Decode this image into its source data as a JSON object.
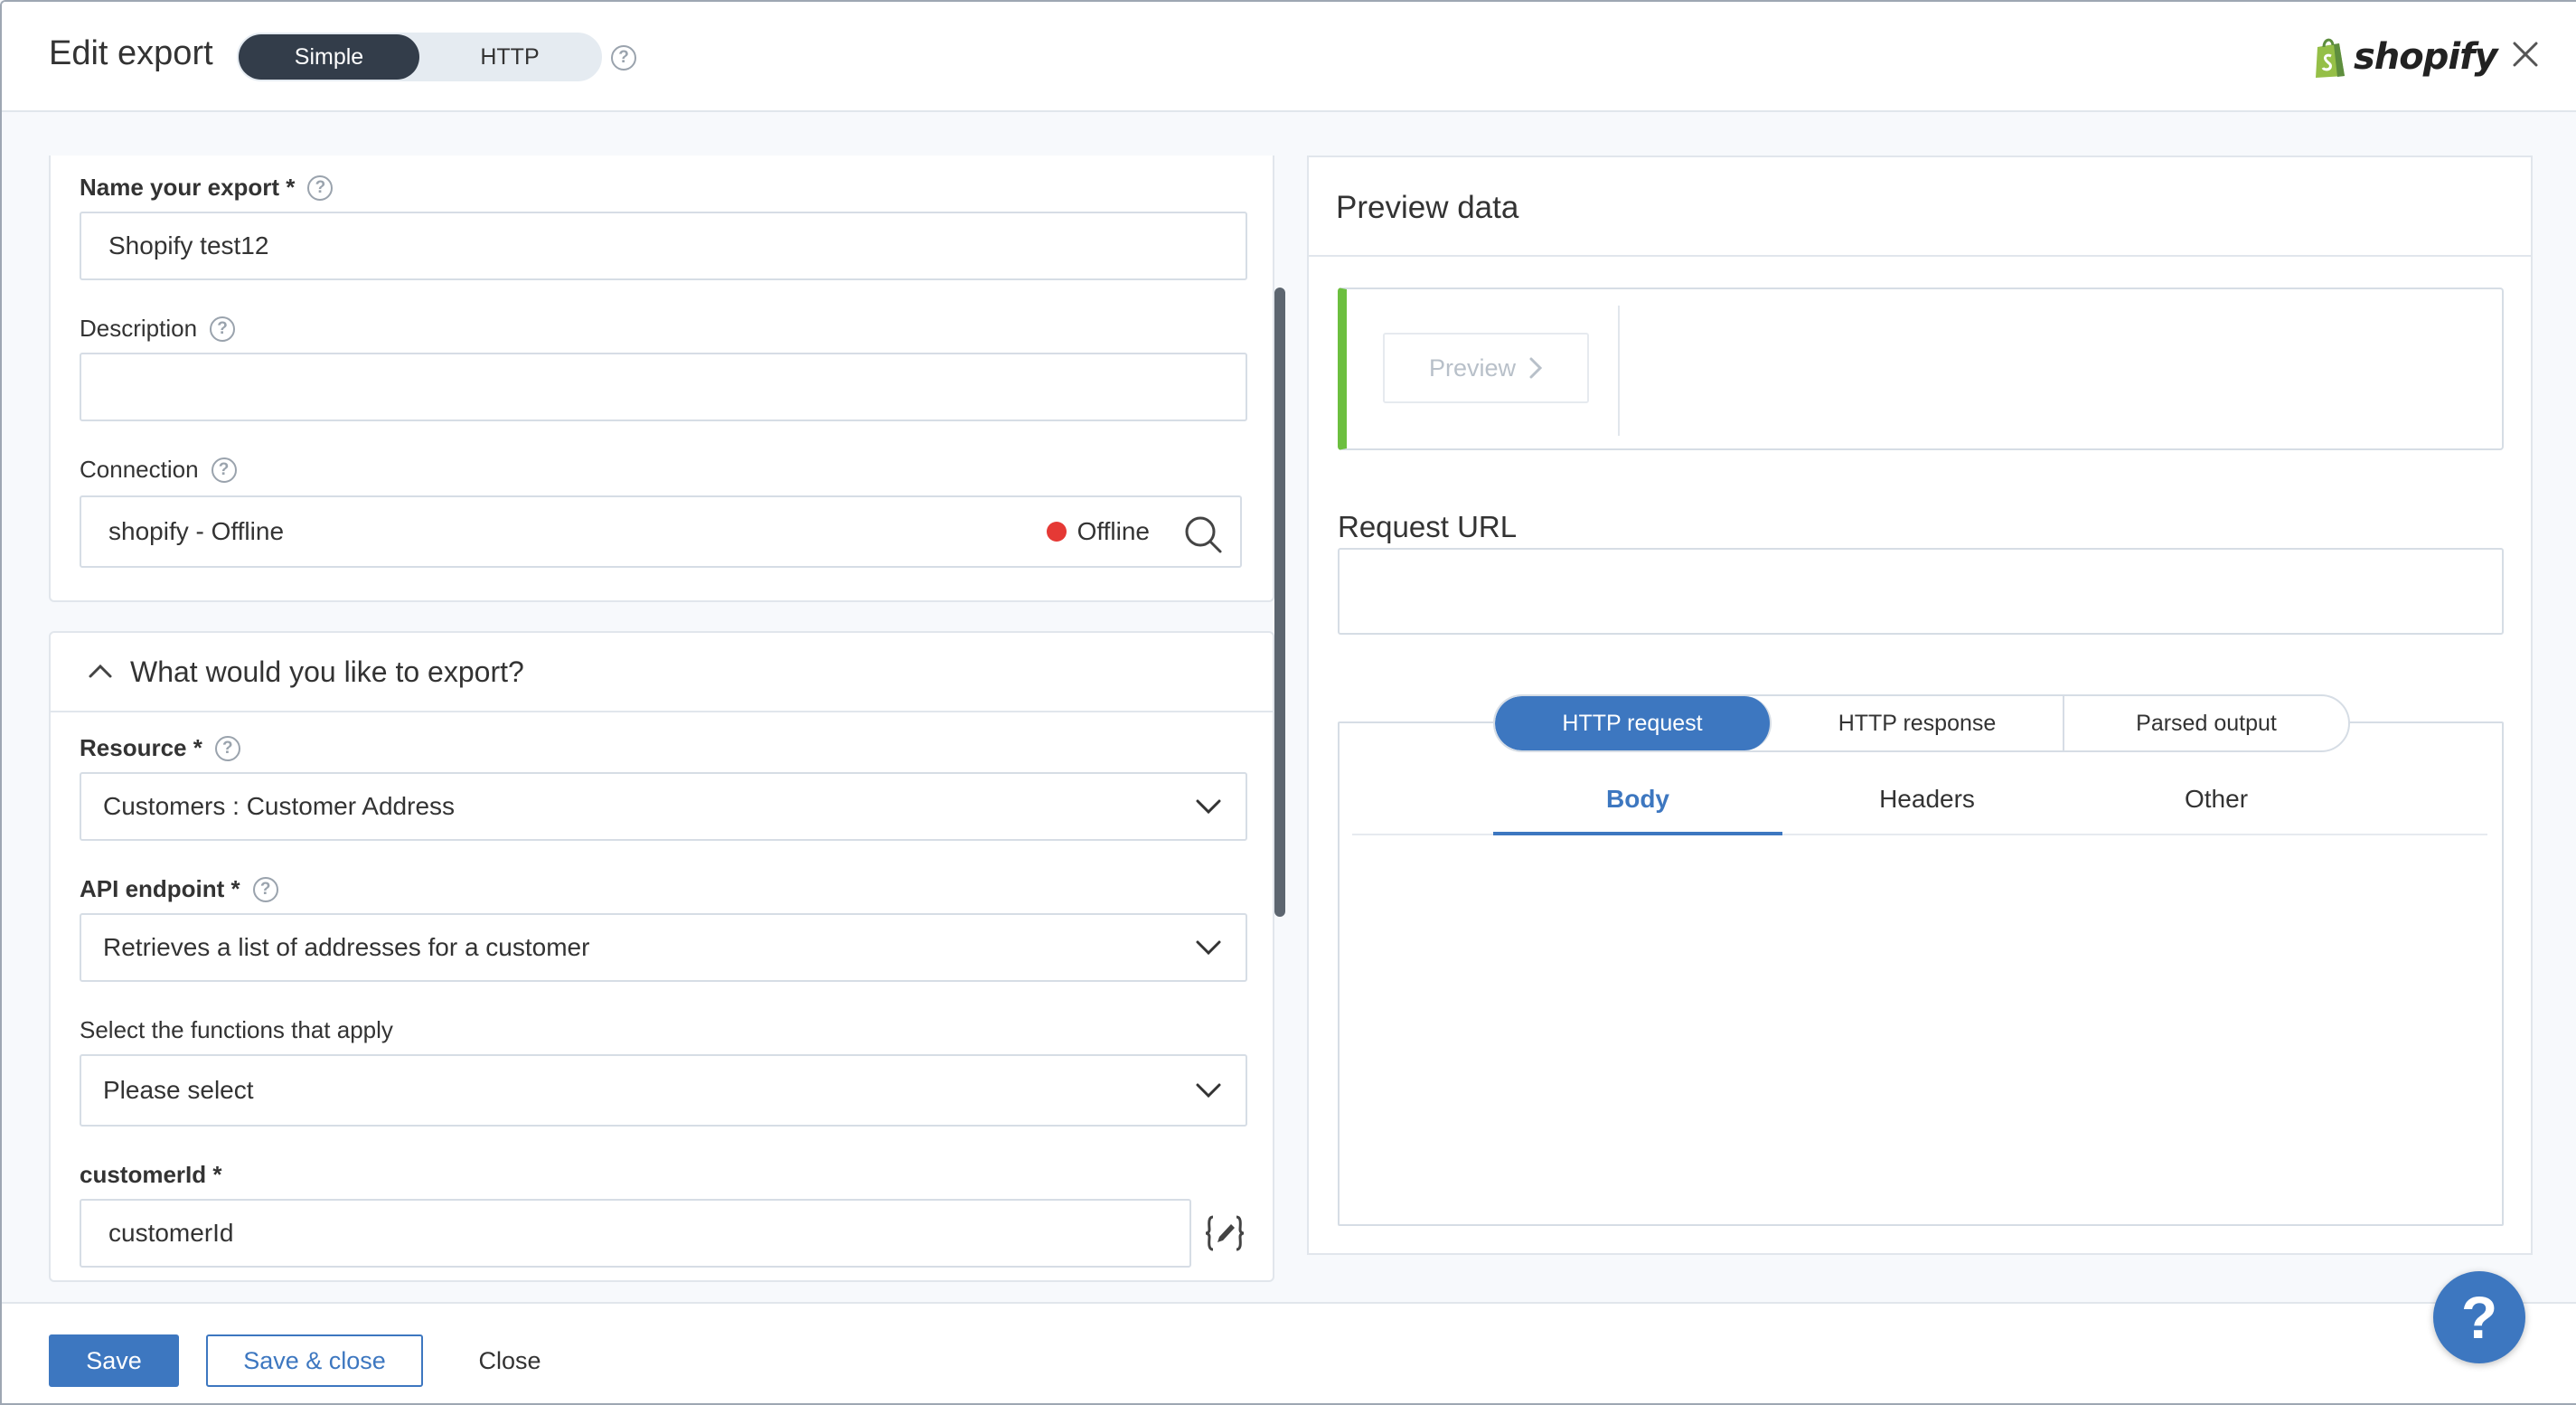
{
  "header": {
    "title": "Edit export",
    "mode_toggle": {
      "options": [
        "Simple",
        "HTTP"
      ],
      "selected": "Simple"
    },
    "logo_text": "shopify"
  },
  "form": {
    "name": {
      "label": "Name your export *",
      "value": "Shopify test12"
    },
    "description": {
      "label": "Description",
      "value": ""
    },
    "connection": {
      "label": "Connection",
      "value": "shopify - Offline",
      "status": "Offline",
      "status_color": "#e53935"
    },
    "export_section": {
      "title": "What would you like to export?"
    },
    "resource": {
      "label": "Resource *",
      "value": "Customers : Customer Address"
    },
    "api_endpoint": {
      "label": "API endpoint *",
      "value": "Retrieves a list of addresses for a customer"
    },
    "functions": {
      "label": "Select the functions that apply",
      "value": "Please select"
    },
    "customer_id": {
      "label": "customerId *",
      "value": "customerId"
    }
  },
  "preview": {
    "title": "Preview data",
    "button": "Preview",
    "request_url_label": "Request URL",
    "request_url_value": "",
    "pill_tabs": [
      "HTTP request",
      "HTTP response",
      "Parsed output"
    ],
    "pill_selected": "HTTP request",
    "sub_tabs": [
      "Body",
      "Headers",
      "Other"
    ],
    "sub_selected": "Body"
  },
  "footer": {
    "save": "Save",
    "save_close": "Save & close",
    "close": "Close"
  },
  "help_fab": "?",
  "colors": {
    "accent": "#3d77c0",
    "offline_dot": "#e53935",
    "preview_bar": "#6cbf3f",
    "toggle_active": "#333d4a"
  }
}
